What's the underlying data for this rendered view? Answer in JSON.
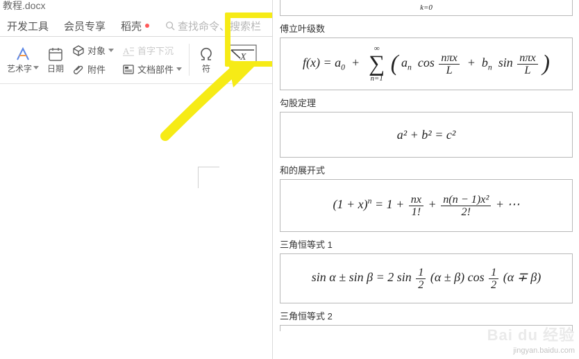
{
  "filename": "教程.docx",
  "tabs": {
    "dev": "开发工具",
    "vip": "会员专享",
    "daoke": "稻壳"
  },
  "search_placeholder": "查找命令、搜索栏",
  "tools": {
    "wordart": "艺术字",
    "date": "日期",
    "object": "对象",
    "attachment": "附件",
    "dropcap": "首字下沉",
    "docparts": "文档部件",
    "symbol": "符",
    "equation": "公式"
  },
  "equations": {
    "partial_top": {
      "sub_k": "k=0"
    },
    "fourier": {
      "label": "傅立叶级数",
      "lhs": "f(x) = a",
      "sub0": "0",
      "sum_top": "∞",
      "sum_bot": "n=1",
      "a_n": "a",
      "a_n_sub": "n",
      "cos": "cos",
      "sin": "sin",
      "frac_top": "nπx",
      "frac_bot": "L",
      "b_n": "b",
      "b_n_sub": "n"
    },
    "pyth": {
      "label": "勾股定理",
      "body": "a² + b² = c²"
    },
    "binom": {
      "label": "和的展开式",
      "left": "(1 + x)",
      "pow_n": "n",
      "eq": " = 1 + ",
      "f1_top": "nx",
      "f1_bot": "1!",
      "plus": " + ",
      "f2_top": "n(n − 1)x²",
      "f2_bot": "2!",
      "dots": " + ⋯"
    },
    "trig1": {
      "label": "三角恒等式 1",
      "body_left": "sin α ± sin β = 2 sin",
      "half_top": "1",
      "half_bot": "2",
      "mid": "(α ± β) cos",
      "half2_top": "1",
      "half2_bot": "2",
      "right": "(α ∓ β)"
    },
    "trig2": {
      "label": "三角恒等式 2"
    }
  },
  "watermark": {
    "main": "Bai du 经验",
    "sub": "jingyan.baidu.com"
  }
}
